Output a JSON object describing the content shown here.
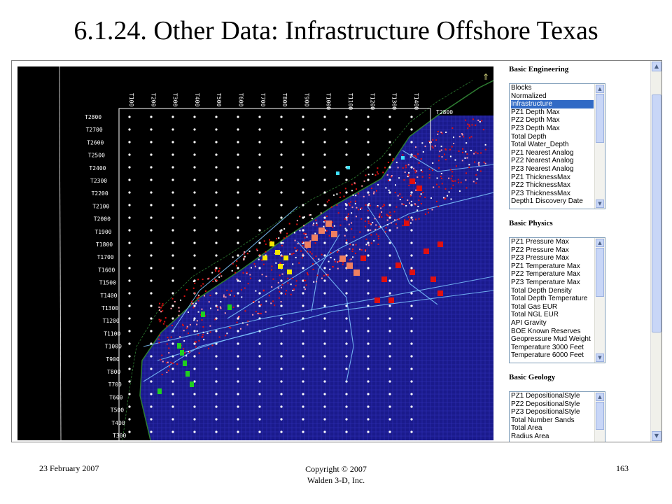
{
  "slide": {
    "title": "6.1.24. Other Data: Infrastructure Offshore Texas"
  },
  "map": {
    "top_labels": [
      "T100",
      "T200",
      "T300",
      "T400",
      "T500",
      "T600",
      "T700",
      "T800",
      "T900",
      "T1000",
      "T1100",
      "T1200",
      "T1300",
      "T1400"
    ],
    "left_labels": [
      "T2800",
      "T2700",
      "T2600",
      "T2500",
      "T2400",
      "T2300",
      "T2200",
      "T2100",
      "T2000",
      "T1900",
      "T1800",
      "T1700",
      "T1600",
      "T1500",
      "T1400",
      "T1300",
      "T1200",
      "T1100",
      "T1000",
      "T900",
      "T800",
      "T700",
      "T600",
      "T500",
      "T400",
      "T300"
    ],
    "right_top_label": "T2800",
    "compass_icon": "north-arrow-icon"
  },
  "panel": {
    "engineering": {
      "heading": "Basic Engineering",
      "items": [
        "Blocks",
        "Normalized",
        "Infrastructure",
        "PZ1 Depth Max",
        "PZ2 Depth Max",
        "PZ3 Depth Max",
        "Total Depth",
        "Total Water_Depth",
        "PZ1 Nearest Analog",
        "PZ2 Nearest Analog",
        "PZ3 Nearest Analog",
        "PZ1 ThicknessMax",
        "PZ2 ThicknessMax",
        "PZ3 ThicknessMax",
        "Depth1 Discovery Date"
      ],
      "selected": "Infrastructure"
    },
    "physics": {
      "heading": "Basic Physics",
      "items": [
        "PZ1 Pressure Max",
        "PZ2 Pressure Max",
        "PZ3 Pressure Max",
        "PZ1 Temperature Max",
        "PZ2 Temperature Max",
        "PZ3 Temperature Max",
        "Total Depth Density",
        "Total Depth Temperature",
        "Total Gas EUR",
        "Total NGL EUR",
        "API Gravity",
        "BOE Known Reserves",
        "Geopressure Mud Weight",
        "Temperature 3000 Feet",
        "Temperature 6000 Feet"
      ]
    },
    "geology": {
      "heading": "Basic Geology",
      "items": [
        "PZ1 DepositionalStyle",
        "PZ2 DepositionalStyle",
        "PZ3 DepositionalStyle",
        "Total Number Sands",
        "Total Area",
        "Radius Area"
      ]
    }
  },
  "footer": {
    "date": "23 February 2007",
    "copyright_line1": "Copyright © 2007",
    "copyright_line2": "Walden 3-D, Inc.",
    "page_number": "163"
  },
  "colors": {
    "map_background": "#000000",
    "ocean": "#1a1a8c",
    "coast": "#2e7d32",
    "selection": "#316ac5",
    "oil_fields": "#e01010",
    "gas_fields": "#f08060",
    "yellow_fields": "#f5e800",
    "green_fields": "#20d020",
    "pipelines": "#80c8ff"
  }
}
